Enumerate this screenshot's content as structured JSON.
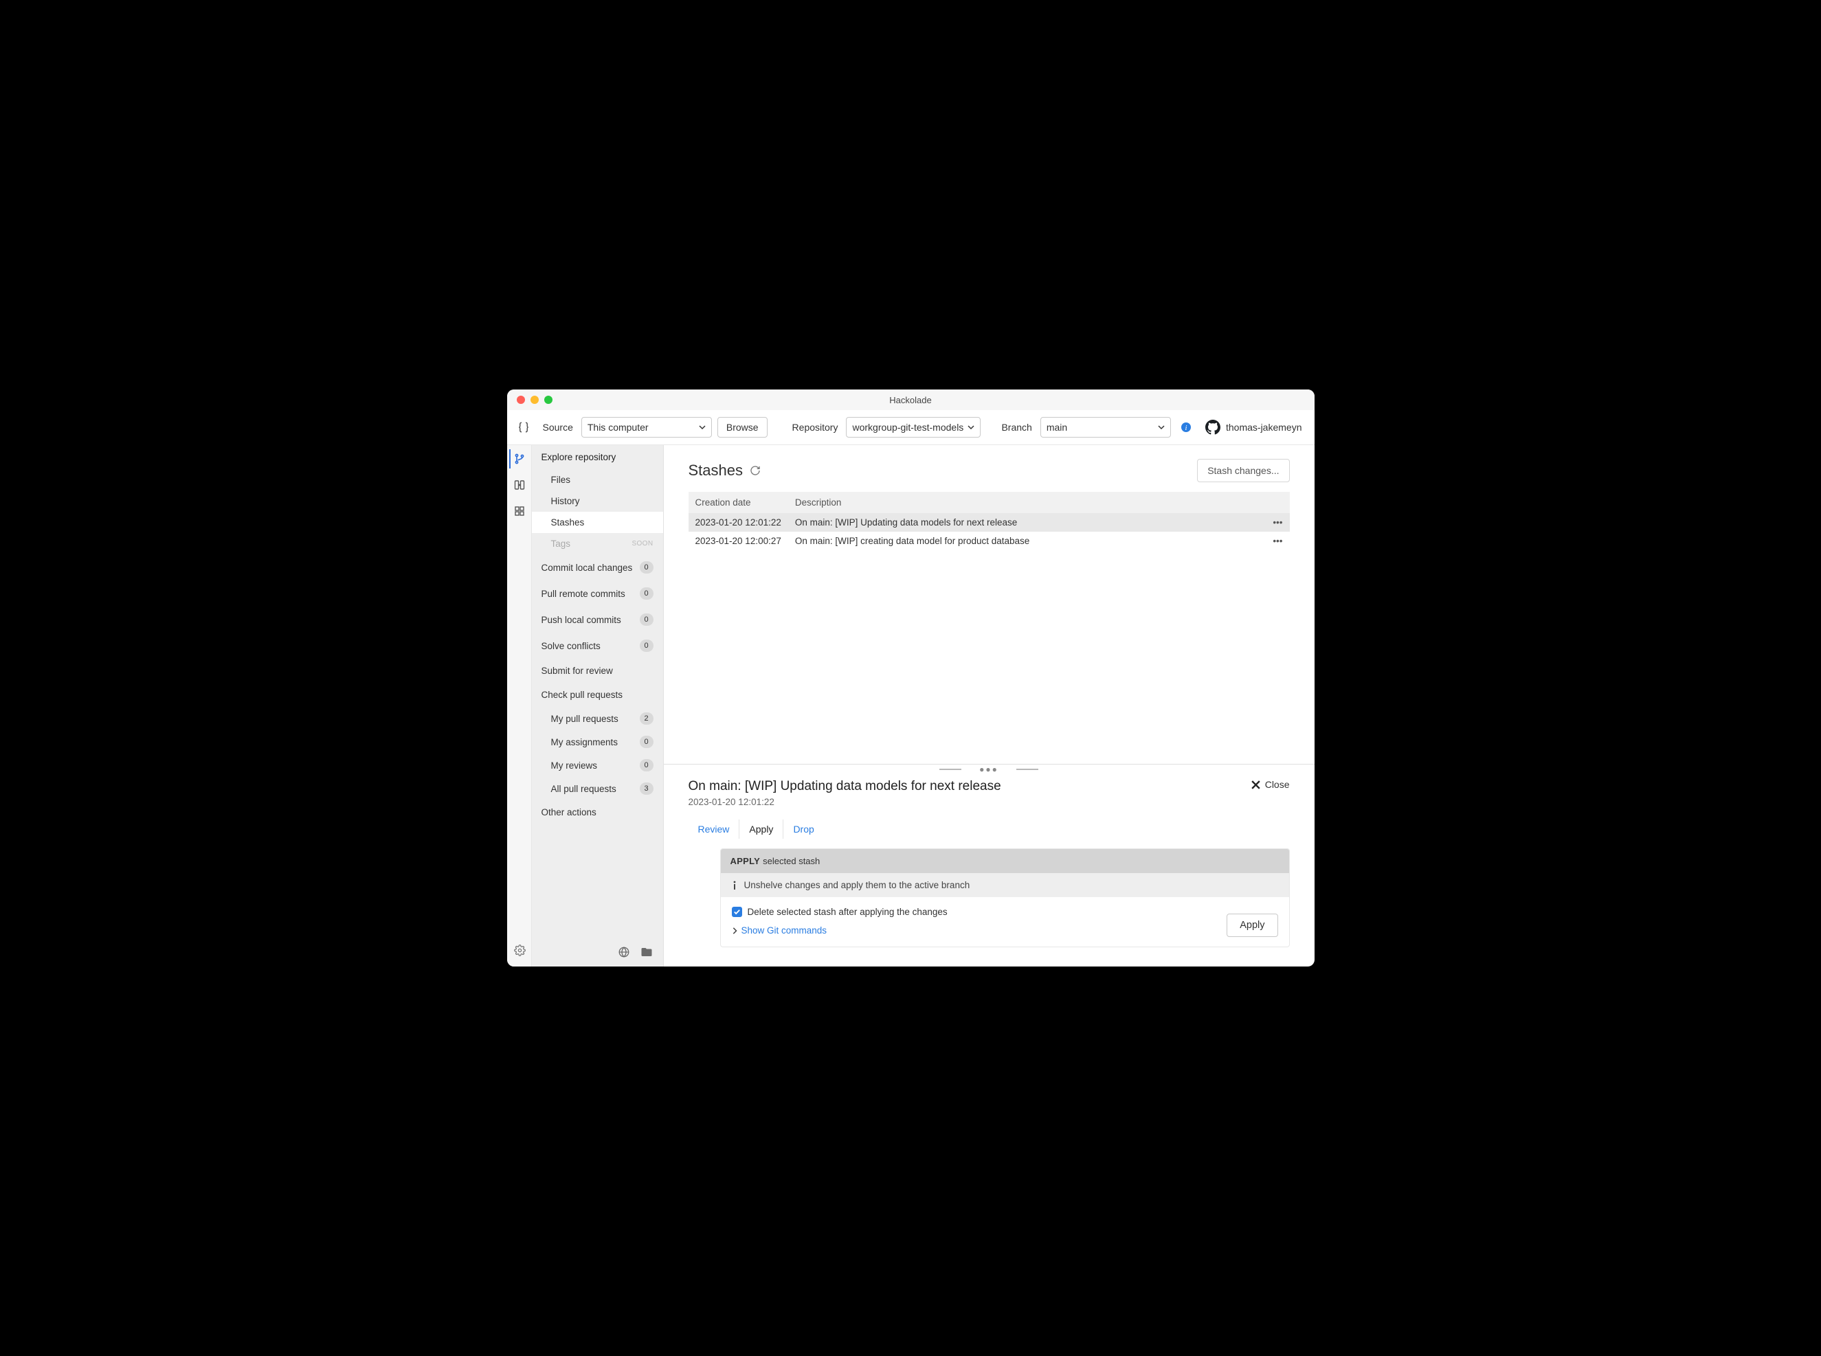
{
  "window": {
    "title": "Hackolade"
  },
  "toolbar": {
    "source_label": "Source",
    "source_value": "This computer",
    "browse_label": "Browse",
    "repository_label": "Repository",
    "repository_value": "workgroup-git-test-models",
    "branch_label": "Branch",
    "branch_value": "main",
    "username": "thomas-jakemeyn"
  },
  "sidebar": {
    "explore": "Explore repository",
    "files": "Files",
    "history": "History",
    "stashes": "Stashes",
    "tags": "Tags",
    "tags_soon": "SOON",
    "commit_local": {
      "label": "Commit local changes",
      "count": "0"
    },
    "pull_remote": {
      "label": "Pull remote commits",
      "count": "0"
    },
    "push_local": {
      "label": "Push local commits",
      "count": "0"
    },
    "solve_conflicts": {
      "label": "Solve conflicts",
      "count": "0"
    },
    "submit_review": "Submit for review",
    "check_prs": "Check pull requests",
    "my_prs": {
      "label": "My pull requests",
      "count": "2"
    },
    "my_assign": {
      "label": "My assignments",
      "count": "0"
    },
    "my_reviews": {
      "label": "My reviews",
      "count": "0"
    },
    "all_prs": {
      "label": "All pull requests",
      "count": "3"
    },
    "other_actions": "Other actions"
  },
  "page": {
    "title": "Stashes",
    "stash_button": "Stash changes...",
    "col_date": "Creation date",
    "col_desc": "Description",
    "rows": [
      {
        "date": "2023-01-20 12:01:22",
        "desc": "On main: [WIP] Updating data models for next release"
      },
      {
        "date": "2023-01-20 12:00:27",
        "desc": "On main: [WIP] creating data model for product database"
      }
    ]
  },
  "detail": {
    "title": "On main: [WIP] Updating data models for next release",
    "date": "2023-01-20 12:01:22",
    "close": "Close",
    "tabs": {
      "review": "Review",
      "apply": "Apply",
      "drop": "Drop"
    },
    "panel": {
      "title_strong": "APPLY",
      "title_rest": "selected stash",
      "info": "Unshelve changes and apply them to the active branch",
      "checkbox": "Delete selected stash after applying the changes",
      "show_cmds": "Show Git commands",
      "apply_btn": "Apply"
    }
  }
}
